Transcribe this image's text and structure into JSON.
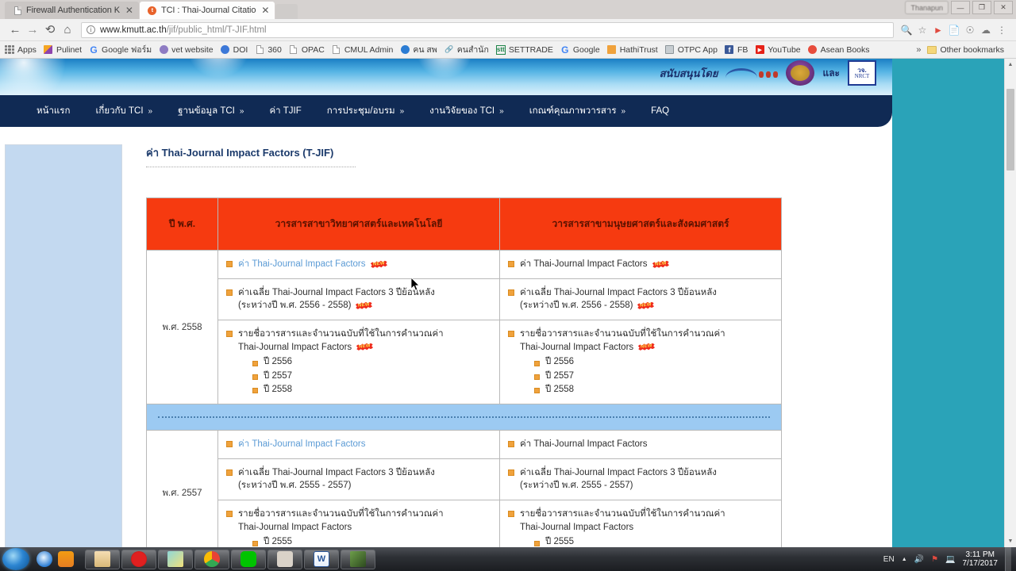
{
  "browser": {
    "tabs": [
      {
        "title": "Firewall Authentication K",
        "favicon": "document-icon",
        "active": false
      },
      {
        "title": "TCI : Thai-Journal Citatio",
        "favicon": "tci-icon",
        "active": true
      }
    ],
    "profile_chip": "Thanapun",
    "window_buttons": {
      "minimize": "—",
      "maximize": "❐",
      "close": "✕"
    },
    "nav": {
      "back": "←",
      "forward": "→",
      "reload": "C",
      "home": "⌂"
    },
    "omnibox": {
      "url_strong": "www.kmutt.ac.th",
      "url_dim": "/jif/public_html/T-JIF.html",
      "info_glyph": "i"
    },
    "toolbar_icons": [
      "zoom-icon",
      "star-icon",
      "extension-icon",
      "page-icon",
      "cast-icon",
      "cloud-icon",
      "menu-icon"
    ],
    "bookmarks": [
      {
        "label": "Apps",
        "icon": "apps-grid-icon",
        "color": "#7a7a7a"
      },
      {
        "label": "Pulinet",
        "icon": "pulinet-icon",
        "color": "#e8820c"
      },
      {
        "label": "Google ฟอร์ม",
        "icon": "google-icon",
        "color": "#4285f4"
      },
      {
        "label": "vet website",
        "icon": "vet-icon",
        "color": "#8e7cc3"
      },
      {
        "label": "DOI",
        "icon": "doi-icon",
        "color": "#3c78d8"
      },
      {
        "label": "360",
        "icon": "document-icon",
        "color": "#9d9d9d"
      },
      {
        "label": "OPAC",
        "icon": "document-icon",
        "color": "#9d9d9d"
      },
      {
        "label": "CMUL Admin",
        "icon": "document-icon",
        "color": "#9d9d9d"
      },
      {
        "label": "คน สพ",
        "icon": "person-icon",
        "color": "#2b7cd3"
      },
      {
        "label": "คนสำนัก",
        "icon": "link-icon",
        "color": "#d88c8c"
      },
      {
        "label": "SETTRADE",
        "icon": "stt-icon",
        "color": "#1e8449"
      },
      {
        "label": "Google",
        "icon": "google-icon",
        "color": "#4285f4"
      },
      {
        "label": "HathiTrust",
        "icon": "hathitrust-icon",
        "color": "#f0a23c"
      },
      {
        "label": "OTPC App",
        "icon": "otpc-icon",
        "color": "#7f8c8d"
      },
      {
        "label": "FB",
        "icon": "facebook-icon",
        "color": "#3b5998"
      },
      {
        "label": "YouTube",
        "icon": "youtube-icon",
        "color": "#e62117"
      },
      {
        "label": "Asean Books",
        "icon": "asean-icon",
        "color": "#e74c3c"
      }
    ],
    "bookmarks_overflow": "»",
    "other_bookmarks": "Other bookmarks"
  },
  "site": {
    "banner": {
      "supported_by": "สนับสนุนโดย",
      "and": "และ",
      "nrct_top": "วจ.",
      "nrct_bottom": "NRCT"
    },
    "nav_items": [
      {
        "label": "หน้าแรก",
        "caret": ""
      },
      {
        "label": "เกี่ยวกับ TCI",
        "caret": "»"
      },
      {
        "label": "ฐานข้อมูล TCI",
        "caret": "»"
      },
      {
        "label": "ค่า TJIF",
        "caret": ""
      },
      {
        "label": "การประชุม/อบรม",
        "caret": "»"
      },
      {
        "label": "งานวิจัยของ TCI",
        "caret": "»"
      },
      {
        "label": "เกณฑ์คุณภาพวารสาร",
        "caret": "»"
      },
      {
        "label": "FAQ",
        "caret": ""
      }
    ],
    "page_title": "ค่า Thai-Journal Impact Factors (T-JIF)",
    "table": {
      "headers": {
        "year": "ปี พ.ศ.",
        "science": "วารสารสาขาวิทยาศาสตร์และเทคโนโลยี",
        "humanities": "วารสารสาขามนุษยศาสตร์และสังคมศาสตร์"
      },
      "new_badge": "NEW",
      "rows": [
        {
          "year": "พ.ศ. 2558",
          "science": [
            {
              "text": "ค่า Thai-Journal Impact Factors",
              "link": true,
              "badge": true,
              "children": []
            },
            {
              "text": "ค่าเฉลี่ย Thai-Journal Impact Factors 3 ปีย้อนหลัง",
              "text2": "(ระหว่างปี พ.ศ. 2556 - 2558)",
              "link": false,
              "badge": true,
              "children": []
            },
            {
              "text": "รายชื่อวารสารและจำนวนฉบับที่ใช้ในการคำนวณค่า",
              "text2": "Thai-Journal Impact Factors",
              "link": false,
              "badge": true,
              "children": [
                "ปี 2556",
                "ปี 2557",
                "ปี 2558"
              ]
            }
          ],
          "humanities": [
            {
              "text": "ค่า Thai-Journal Impact Factors",
              "link": false,
              "badge": true,
              "children": []
            },
            {
              "text": "ค่าเฉลี่ย Thai-Journal Impact Factors 3 ปีย้อนหลัง",
              "text2": "(ระหว่างปี พ.ศ. 2556 - 2558)",
              "link": false,
              "badge": true,
              "children": []
            },
            {
              "text": "รายชื่อวารสารและจำนวนฉบับที่ใช้ในการคำนวณค่า",
              "text2": "Thai-Journal Impact Factors",
              "link": false,
              "badge": true,
              "children": [
                "ปี 2556",
                "ปี 2557",
                "ปี 2558"
              ]
            }
          ]
        },
        {
          "year": "พ.ศ. 2557",
          "science": [
            {
              "text": "ค่า Thai-Journal Impact Factors",
              "link": true,
              "badge": false,
              "children": []
            },
            {
              "text": "ค่าเฉลี่ย Thai-Journal Impact Factors 3 ปีย้อนหลัง",
              "text2": "(ระหว่างปี พ.ศ. 2555 - 2557)",
              "link": false,
              "badge": false,
              "children": []
            },
            {
              "text": "รายชื่อวารสารและจำนวนฉบับที่ใช้ในการคำนวณค่า",
              "text2": "Thai-Journal Impact Factors",
              "link": false,
              "badge": false,
              "children": [
                "ปี 2555"
              ]
            }
          ],
          "humanities": [
            {
              "text": "ค่า Thai-Journal Impact Factors",
              "link": false,
              "badge": false,
              "children": []
            },
            {
              "text": "ค่าเฉลี่ย Thai-Journal Impact Factors 3 ปีย้อนหลัง",
              "text2": "(ระหว่างปี พ.ศ. 2555 - 2557)",
              "link": false,
              "badge": false,
              "children": []
            },
            {
              "text": "รายชื่อวารสารและจำนวนฉบับที่ใช้ในการคำนวณค่า",
              "text2": "Thai-Journal Impact Factors",
              "link": false,
              "badge": false,
              "children": [
                "ปี 2555"
              ]
            }
          ]
        }
      ]
    }
  },
  "taskbar": {
    "quicklaunch": [
      "ie-icon",
      "media-player-icon"
    ],
    "tasks": [
      "explorer-icon",
      "opera-icon",
      "folder-icon",
      "chrome-icon",
      "line-icon",
      "snip-icon",
      "word-icon",
      "photo-icon"
    ],
    "tray": {
      "language": "EN",
      "up_arrow": "▲",
      "volume": "volume-icon",
      "security": "security-icon",
      "network": "network-icon"
    },
    "clock_time": "3:11 PM",
    "clock_date": "7/17/2017"
  },
  "colors": {
    "accent_orange": "#f63a10",
    "nav_blue": "#102a54",
    "link_blue": "#5b9bd5",
    "desktop_teal": "#2aa3b8",
    "separator_blue": "#9ccaf2"
  }
}
